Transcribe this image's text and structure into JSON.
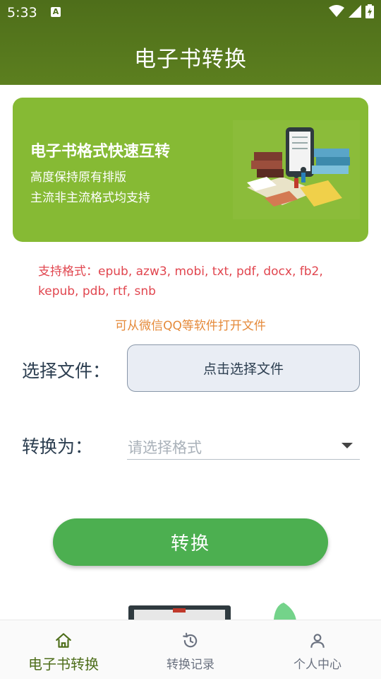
{
  "status_bar": {
    "time": "5:33",
    "notification_badge": "A"
  },
  "header": {
    "title": "电子书转换"
  },
  "banner": {
    "title": "电子书格式快速互转",
    "line1": "高度保持原有排版",
    "line2": "主流非主流格式均支持"
  },
  "formats_text": "支持格式：epub, azw3, mobi, txt, pdf, docx, fb2, kepub, pdb, rtf, snb",
  "hint": "可从微信QQ等软件打开文件",
  "file_row": {
    "label": "选择文件：",
    "button": "点击选择文件"
  },
  "convert_row": {
    "label": "转换为：",
    "placeholder": "请选择格式"
  },
  "convert_button": "转换",
  "bottom_nav": {
    "items": [
      {
        "label": "电子书转换",
        "icon": "home-icon",
        "active": true
      },
      {
        "label": "转换记录",
        "icon": "history-icon",
        "active": false
      },
      {
        "label": "个人中心",
        "icon": "person-icon",
        "active": false
      }
    ]
  },
  "colors": {
    "header": "#4e6e1a",
    "banner": "#86ba34",
    "accent_green": "#4caf50",
    "format_text": "#e1464f",
    "hint_text": "#e58a3a",
    "active_nav": "#4e6e1a"
  }
}
